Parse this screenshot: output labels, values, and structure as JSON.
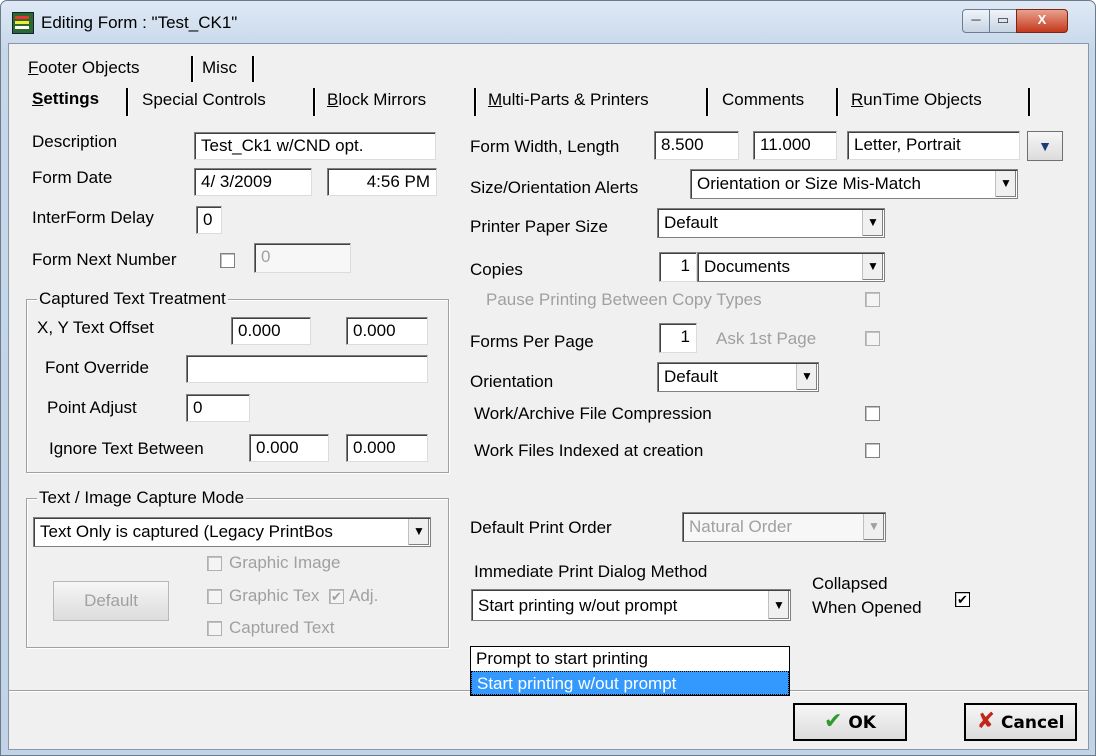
{
  "window": {
    "title": "Editing Form : \"Test_CK1\"",
    "controls": {
      "minimize": "─",
      "maximize": "▭",
      "close": "X"
    }
  },
  "tabs": {
    "row1": [
      {
        "u": "F",
        "rest": "ooter Objects"
      },
      {
        "u": "",
        "rest": "Misc"
      }
    ],
    "row2": [
      {
        "u": "S",
        "rest": "ettings"
      },
      {
        "u": "",
        "rest": "Special Controls"
      },
      {
        "u": "B",
        "rest": "lock Mirrors"
      },
      {
        "u": "M",
        "rest": "ulti-Parts & Printers"
      },
      {
        "u": "",
        "rest": "Comments"
      },
      {
        "u": "R",
        "rest": "unTime Objects"
      }
    ]
  },
  "left": {
    "description": {
      "label": "Description",
      "value": "Test_Ck1 w/CND opt."
    },
    "form_date": {
      "label": "Form Date",
      "date": "4/ 3/2009",
      "time": "4:56 PM"
    },
    "interform_delay": {
      "label": "InterForm Delay",
      "value": "0"
    },
    "form_next_number": {
      "label": "Form Next Number",
      "value": "0",
      "checked": false
    },
    "captured_text": {
      "title": "Captured Text Treatment",
      "xy_label": "X, Y Text Offset",
      "x": "0.000",
      "y": "0.000",
      "font_label": "Font Override",
      "font_value": "",
      "point_label": "Point Adjust",
      "point_value": "0",
      "ignore_label": "Ignore Text  Between",
      "ignore_from": "0.000",
      "ignore_to": "0.000"
    },
    "capture_mode": {
      "title": "Text / Image Capture Mode",
      "selected": "Text Only is captured (Legacy PrintBos",
      "default_button": "Default",
      "graphic_image": "Graphic Image",
      "graphic_text": "Graphic Tex",
      "adj": "Adj.",
      "captured_text": "Captured Text"
    }
  },
  "right": {
    "form_width_length": {
      "label": "Form Width, Length",
      "width": "8.500",
      "length": "11.000",
      "paper": "Letter, Portrait"
    },
    "size_alerts": {
      "label": "Size/Orientation Alerts",
      "value": "Orientation or Size Mis-Match"
    },
    "printer_paper_size": {
      "label": "Printer Paper Size",
      "value": "Default"
    },
    "copies": {
      "label": "Copies",
      "count": "1",
      "type": "Documents"
    },
    "pause_printing": {
      "label": "Pause Printing Between Copy Types"
    },
    "forms_per_page": {
      "label": "Forms Per Page",
      "value": "1",
      "ask_label": "Ask 1st Page"
    },
    "orientation": {
      "label": "Orientation",
      "value": "Default"
    },
    "compression": {
      "label": "Work/Archive File Compression"
    },
    "indexed": {
      "label": "Work Files Indexed at creation"
    },
    "default_print_order": {
      "label": "Default Print Order",
      "value": "Natural Order"
    },
    "immediate_print": {
      "label": "Immediate Print Dialog Method",
      "value": "Start printing w/out prompt",
      "options": [
        "Prompt to start printing",
        "Start printing w/out prompt"
      ],
      "selected_index": 1
    },
    "collapsed": {
      "line1": "Collapsed",
      "line2": "When Opened",
      "checked": true
    }
  },
  "buttons": {
    "ok": "OK",
    "ok_icon": "✔",
    "cancel": "Cancel",
    "cancel_icon": "✘"
  },
  "colors": {
    "accent": "#3399ff",
    "ok_check": "#2e9b2e",
    "cancel_x": "#c0261a"
  }
}
